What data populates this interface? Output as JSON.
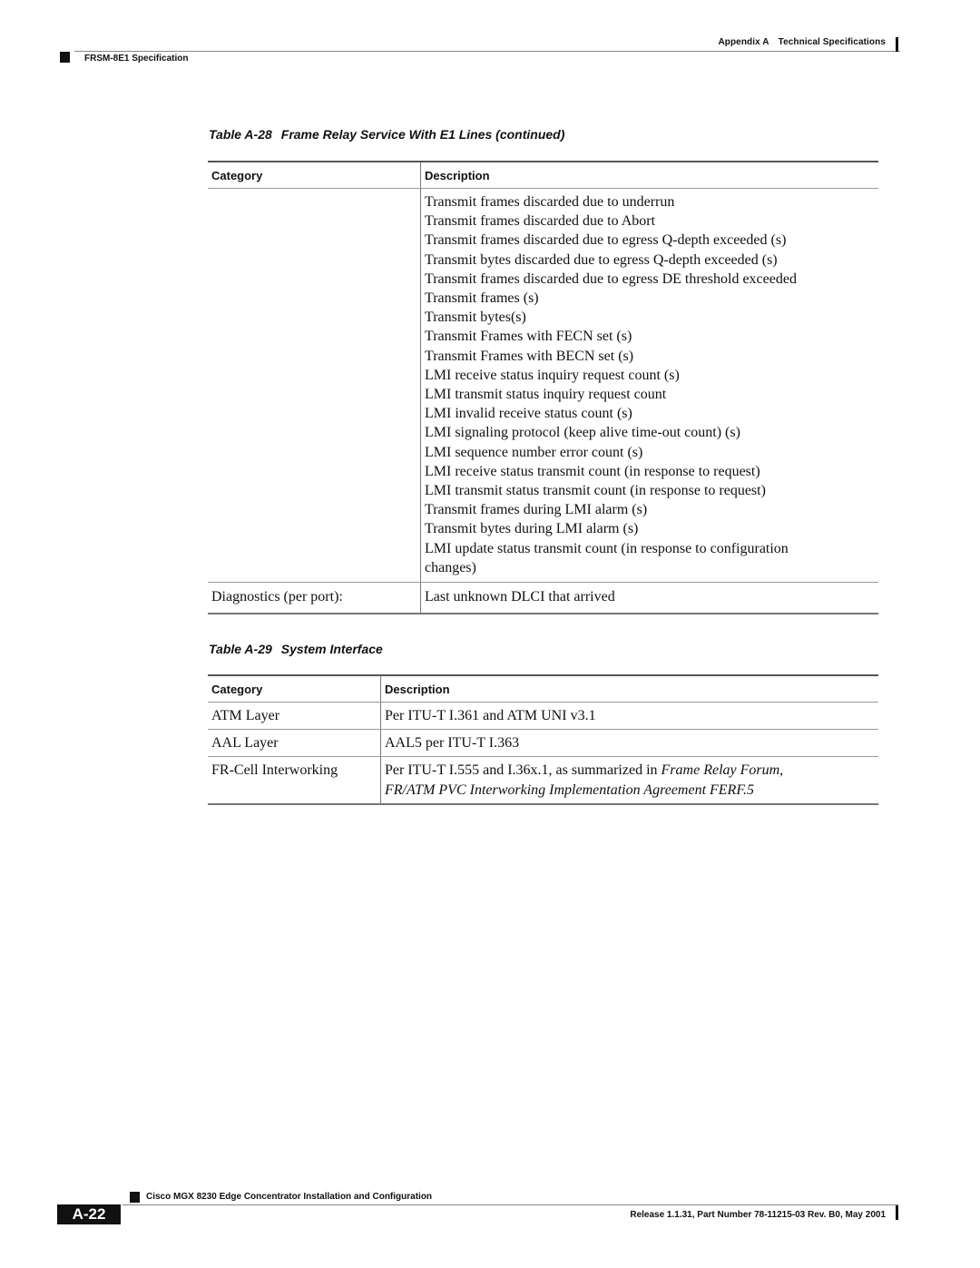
{
  "header": {
    "appendix_label": "Appendix A",
    "chapter_title": "Technical Specifications",
    "section_title": "FRSM-8E1 Specification"
  },
  "table_a28": {
    "number": "Table A-28",
    "title": "Frame Relay Service With E1 Lines (continued)",
    "columns": [
      "Category",
      "Description"
    ],
    "rows": [
      {
        "category": "",
        "description_lines": [
          "Transmit frames discarded due to underrun",
          "Transmit frames discarded due to Abort",
          "Transmit frames discarded due to egress Q-depth exceeded (s)",
          "Transmit bytes discarded due to egress Q-depth exceeded (s)",
          "Transmit frames discarded due to egress DE threshold exceeded",
          "Transmit frames (s)",
          "Transmit bytes(s)",
          "Transmit Frames with FECN set (s)",
          "Transmit Frames with BECN set (s)",
          "LMI receive status inquiry request count (s)",
          "LMI transmit status inquiry request count",
          "LMI invalid receive status count (s)",
          "LMI signaling protocol (keep alive time-out count) (s)",
          "LMI sequence number error count (s)",
          "LMI receive status transmit count (in response to request)",
          "LMI transmit status transmit count (in response to request)",
          "Transmit frames during LMI alarm (s)",
          "Transmit bytes during LMI alarm (s)",
          "LMI update status transmit count (in response to configuration",
          "changes)"
        ]
      },
      {
        "category": "Diagnostics (per port):",
        "description": "Last unknown DLCI that arrived"
      }
    ]
  },
  "table_a29": {
    "number": "Table A-29",
    "title": "System Interface",
    "columns": [
      "Category",
      "Description"
    ],
    "rows": [
      {
        "category": "ATM Layer",
        "description": "Per ITU-T I.361 and ATM UNI v3.1"
      },
      {
        "category": "AAL Layer",
        "description": "AAL5 per ITU-T I.363"
      },
      {
        "category": "FR-Cell Interworking",
        "description_plain": "Per ITU-T I.555 and I.36x.1, as summarized in ",
        "description_italic_1": "Frame Relay Forum,",
        "description_italic_2": "FR/ATM PVC Interworking Implementation Agreement FERF.5"
      }
    ]
  },
  "footer": {
    "book_title": "Cisco MGX 8230 Edge Concentrator Installation and Configuration",
    "page_number": "A-22",
    "release_info": "Release 1.1.31, Part Number 78-11215-03 Rev. B0, May 2001"
  }
}
